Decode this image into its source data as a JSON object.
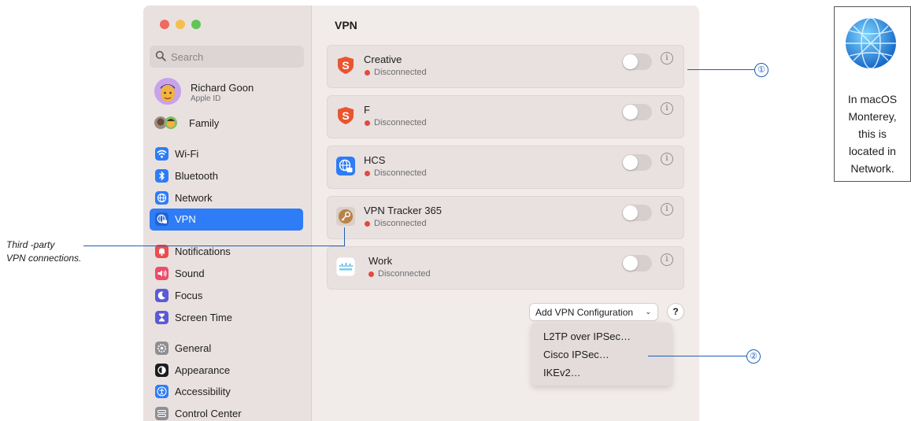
{
  "window": {
    "title": "VPN"
  },
  "sidebar": {
    "search_placeholder": "Search",
    "profile": {
      "name": "Richard Goon",
      "subtitle": "Apple ID"
    },
    "family_label": "Family",
    "items": [
      {
        "label": "Wi-Fi",
        "icon": "wifi-icon"
      },
      {
        "label": "Bluetooth",
        "icon": "bluetooth-icon"
      },
      {
        "label": "Network",
        "icon": "network-icon"
      },
      {
        "label": "VPN",
        "icon": "vpn-icon",
        "selected": true
      },
      {
        "label": "Notifications",
        "icon": "notifications-icon"
      },
      {
        "label": "Sound",
        "icon": "sound-icon"
      },
      {
        "label": "Focus",
        "icon": "focus-icon"
      },
      {
        "label": "Screen Time",
        "icon": "screen-time-icon"
      },
      {
        "label": "General",
        "icon": "general-icon"
      },
      {
        "label": "Appearance",
        "icon": "appearance-icon"
      },
      {
        "label": "Accessibility",
        "icon": "accessibility-icon"
      },
      {
        "label": "Control Center",
        "icon": "control-center-icon"
      }
    ]
  },
  "main": {
    "vpns": [
      {
        "name": "Creative",
        "status": "Disconnected",
        "icon": "shield-s-icon"
      },
      {
        "name": "F",
        "status": "Disconnected",
        "icon": "shield-s-icon"
      },
      {
        "name": "HCS",
        "status": "Disconnected",
        "icon": "globe-lock-icon"
      },
      {
        "name": "VPN Tracker 365",
        "status": "Disconnected",
        "icon": "key-icon"
      },
      {
        "name": "Work",
        "status": "Disconnected",
        "icon": "cisco-icon"
      }
    ],
    "info_glyph": "i",
    "add_button_label": "Add VPN Configuration",
    "help_label": "?",
    "menu_items": [
      "L2TP over IPSec…",
      "Cisco IPSec…",
      "IKEv2…"
    ]
  },
  "annotations": {
    "callout_1": "①",
    "callout_2": "②",
    "third_party_line1": "Third -party",
    "third_party_line2": "VPN connections.",
    "note_line1": "In macOS",
    "note_line2": "Monterey,",
    "note_line3": "this is",
    "note_line4": "located in",
    "note_line5": "Network."
  },
  "colors": {
    "accent": "#2e7cf6",
    "status_red": "#e5483f",
    "callout": "#1f5fb5"
  }
}
